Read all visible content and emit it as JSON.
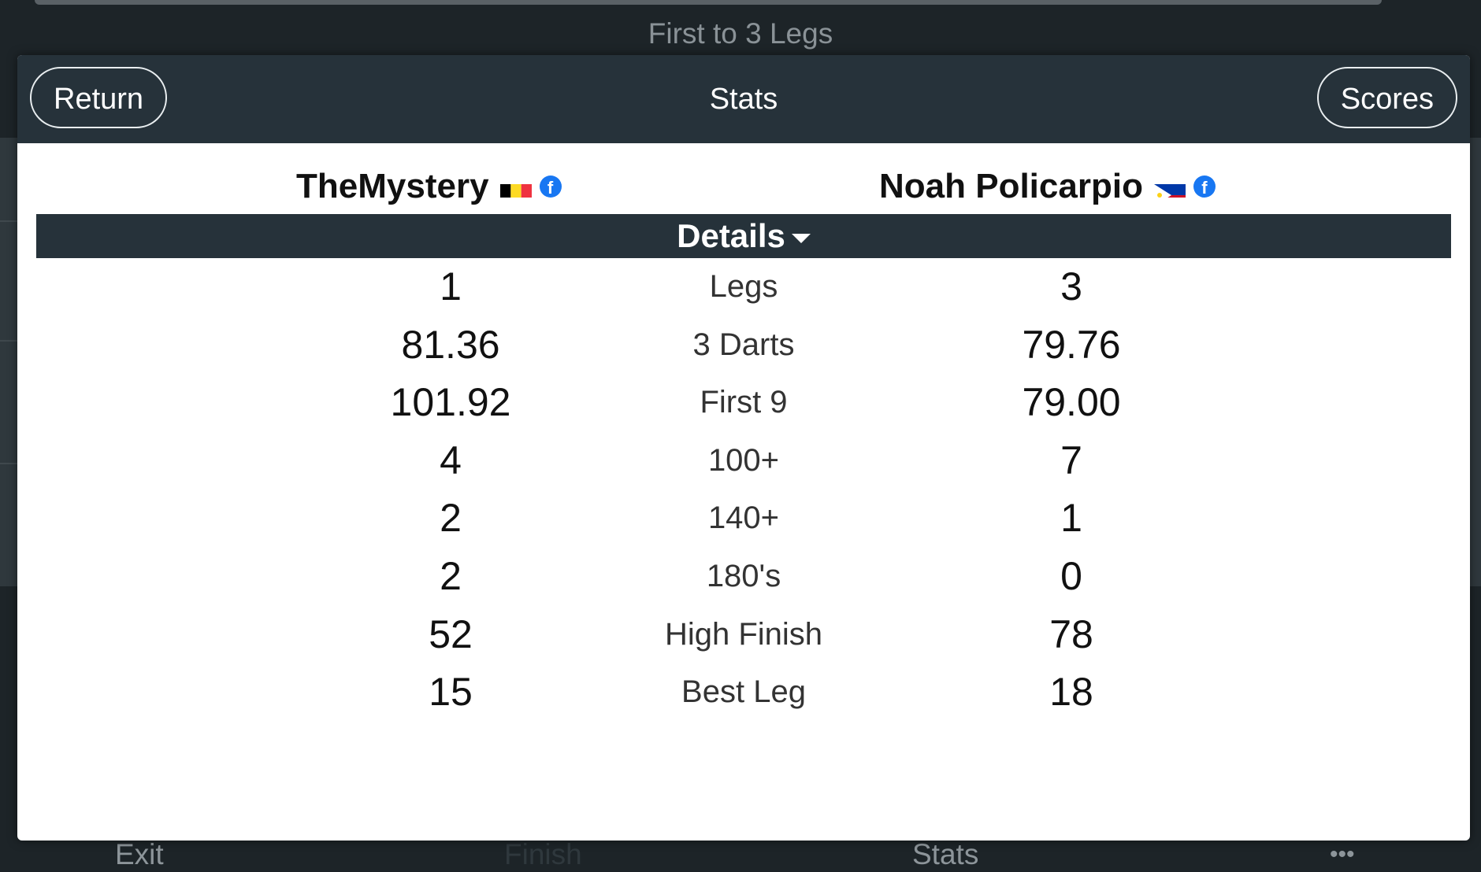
{
  "background": {
    "subtitle": "First to 3 Legs",
    "bottom_nav": [
      "Exit",
      "Finish",
      "Stats",
      "•••"
    ]
  },
  "modal": {
    "return_label": "Return",
    "title": "Stats",
    "scores_label": "Scores",
    "details_label": "Details"
  },
  "players": [
    {
      "name": "TheMystery",
      "flag": "belgium-flag-icon",
      "social": "f"
    },
    {
      "name": "Noah Policarpio",
      "flag": "philippines-flag-icon",
      "social": "f"
    }
  ],
  "stats": [
    {
      "label": "Legs",
      "p1": "1",
      "p2": "3"
    },
    {
      "label": "3 Darts",
      "p1": "81.36",
      "p2": "79.76"
    },
    {
      "label": "First 9",
      "p1": "101.92",
      "p2": "79.00"
    },
    {
      "label": "100+",
      "p1": "4",
      "p2": "7"
    },
    {
      "label": "140+",
      "p1": "2",
      "p2": "1"
    },
    {
      "label": "180's",
      "p1": "2",
      "p2": "0"
    },
    {
      "label": "High Finish",
      "p1": "52",
      "p2": "78"
    },
    {
      "label": "Best Leg",
      "p1": "15",
      "p2": "18"
    }
  ],
  "colors": {
    "header": "#26323a",
    "facebook": "#1877f2"
  }
}
